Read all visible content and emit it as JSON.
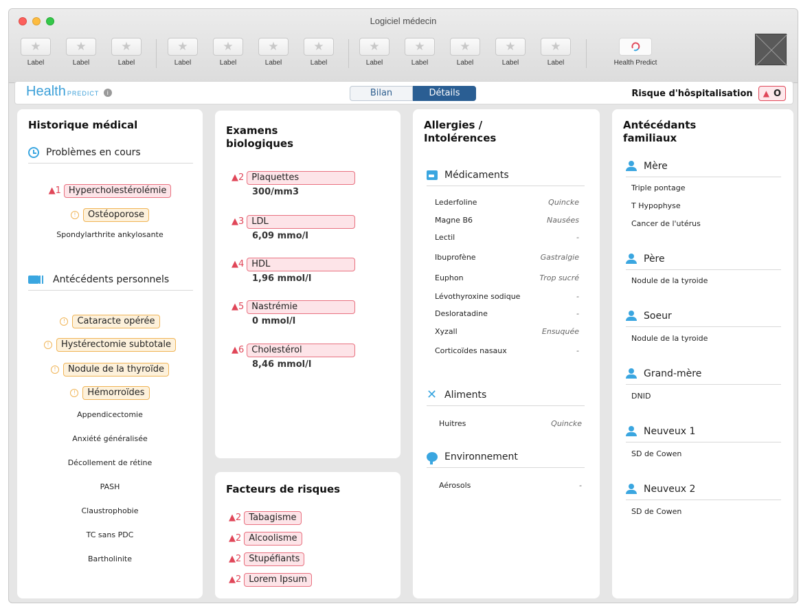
{
  "window": {
    "title": "Logiciel médecin"
  },
  "toolbar": {
    "buttons": [
      "Label",
      "Label",
      "Label",
      "Label",
      "Label",
      "Label",
      "Label",
      "Label",
      "Label",
      "Label",
      "Label",
      "Label"
    ],
    "health_predict_label": "Health Predict"
  },
  "header": {
    "logo_main": "Health",
    "logo_sub": "PREDICT",
    "info_symbol": "i",
    "tabs": [
      {
        "label": "Bilan",
        "active": false
      },
      {
        "label": "Détails",
        "active": true
      }
    ],
    "risk_label": "Risque d'hôspitalisation",
    "risk_value": "O"
  },
  "history": {
    "title": "Historique médical",
    "current": {
      "title": "Problèmes en cours",
      "items": [
        {
          "label": "Hypercholestérolémie",
          "level": "red",
          "severity": "1"
        },
        {
          "label": "Ostéoporose",
          "level": "orange"
        },
        {
          "label": "Spondylarthrite ankylosante",
          "level": "none"
        }
      ]
    },
    "personal": {
      "title": "Antécédents personnels",
      "items": [
        {
          "label": "Cataracte opérée",
          "level": "orange"
        },
        {
          "label": "Hystérectomie subtotale",
          "level": "orange"
        },
        {
          "label": "Nodule de la thyroïde",
          "level": "orange"
        },
        {
          "label": "Hémorroïdes",
          "level": "orange"
        },
        {
          "label": "Appendicectomie",
          "level": "none"
        },
        {
          "label": "Anxiété généralisée",
          "level": "none"
        },
        {
          "label": "Décollement de rétine",
          "level": "none"
        },
        {
          "label": "PASH",
          "level": "none"
        },
        {
          "label": "Claustrophobie",
          "level": "none"
        },
        {
          "label": "TC sans PDC",
          "level": "none"
        },
        {
          "label": "Bartholinite",
          "level": "none"
        }
      ]
    }
  },
  "exams": {
    "title": "Examens biologiques",
    "items": [
      {
        "severity": "2",
        "label": "Plaquettes",
        "value": "300/mm3"
      },
      {
        "severity": "3",
        "label": "LDL",
        "value": "6,09 mmo/l"
      },
      {
        "severity": "4",
        "label": "HDL",
        "value": "1,96 mmol/l"
      },
      {
        "severity": "5",
        "label": "Nastrémie",
        "value": "0 mmol/l"
      },
      {
        "severity": "6",
        "label": "Cholestérol",
        "value": "8,46 mmol/l"
      }
    ]
  },
  "risk_factors": {
    "title": "Facteurs de risques",
    "items": [
      {
        "severity": "2",
        "label": "Tabagisme"
      },
      {
        "severity": "2",
        "label": "Alcoolisme"
      },
      {
        "severity": "2",
        "label": "Stupéfiants"
      },
      {
        "severity": "2",
        "label": "Lorem Ipsum"
      }
    ]
  },
  "allergies": {
    "title": "Allergies / Intolérences",
    "medications": {
      "title": "Médicaments",
      "rows": [
        {
          "name": "Lederfoline",
          "reaction": "Quincke"
        },
        {
          "name": "Magne B6",
          "reaction": "Nausées"
        },
        {
          "name": "Lectil",
          "reaction": "-"
        },
        {
          "name": "Ibuprofène",
          "reaction": "Gastralgie"
        },
        {
          "name": "Euphon",
          "reaction": "Trop sucré"
        },
        {
          "name": "Lévothyroxine sodique",
          "reaction": "-"
        },
        {
          "name": "Desloratadine",
          "reaction": "-"
        },
        {
          "name": "Xyzall",
          "reaction": "Ensuquée"
        },
        {
          "name": "Corticoïdes nasaux",
          "reaction": "-"
        }
      ]
    },
    "food": {
      "title": "Aliments",
      "rows": [
        {
          "name": "Huitres",
          "reaction": "Quincke"
        }
      ]
    },
    "environment": {
      "title": "Environnement",
      "rows": [
        {
          "name": "Aérosols",
          "reaction": "-"
        }
      ]
    }
  },
  "family": {
    "title": "Antécédants familiaux",
    "members": [
      {
        "relation": "Mère",
        "items": [
          "Triple pontage",
          "T Hypophyse",
          "Cancer de l'utérus"
        ]
      },
      {
        "relation": "Père",
        "items": [
          "Nodule de la tyroide"
        ]
      },
      {
        "relation": "Soeur",
        "items": [
          "Nodule de la tyroide"
        ]
      },
      {
        "relation": "Grand-mère",
        "items": [
          "DNID"
        ]
      },
      {
        "relation": "Neuveux 1",
        "items": [
          "SD de Cowen"
        ]
      },
      {
        "relation": "Neuveux 2",
        "items": [
          "SD de Cowen"
        ]
      }
    ]
  },
  "colors": {
    "accent": "#3aa6e0",
    "alert_red": "#e04759",
    "warning_orange": "#f0b456",
    "active_tab": "#2a5e93"
  }
}
